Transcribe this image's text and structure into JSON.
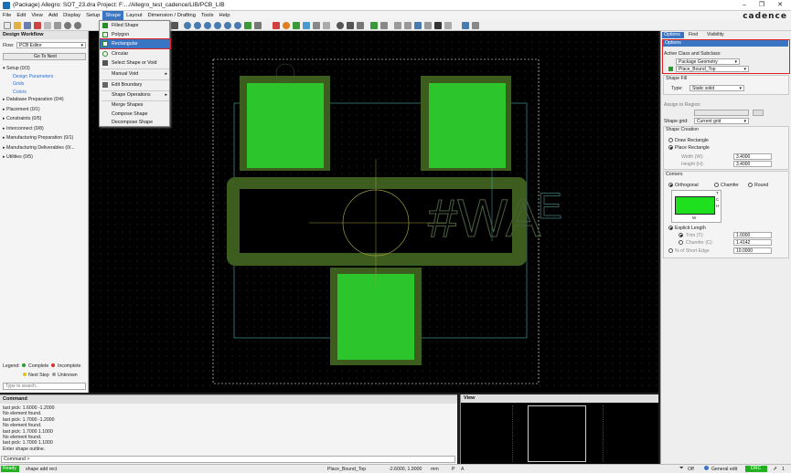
{
  "titlebar": {
    "title": "(Package) Allegro: SOT_23.dra  Project: F:.../Allegro_test_cadence/LIB/PCB_LIB"
  },
  "menubar": {
    "items": [
      "File",
      "Edit",
      "View",
      "Add",
      "Display",
      "Setup",
      "Shape",
      "Layout",
      "Dimension / Drafting",
      "Tools",
      "Help"
    ],
    "active": "Shape"
  },
  "brand": "cadence",
  "shape_menu": {
    "items": [
      "Filled Shape",
      "Polygon",
      "Rectangular",
      "Circular",
      "Select Shape or Void",
      "Manual Void",
      "Edit Boundary",
      "Shape Operations",
      "Merge Shapes",
      "Compose Shape",
      "Decompose Shape"
    ],
    "highlighted": "Rectangular"
  },
  "workflow": {
    "title": "Design Workflow",
    "flow_label": "Flow:",
    "flow_value": "PCB Editor",
    "go_next": "Go To Next",
    "tree": [
      {
        "label": "Setup (0/3)"
      },
      {
        "label": "Design Parameters",
        "sub": true
      },
      {
        "label": "Grids",
        "sub": true
      },
      {
        "label": "Colors",
        "sub": true
      },
      {
        "label": "Database Preparation (0/4)"
      },
      {
        "label": "Placement (0/1)"
      },
      {
        "label": "Constraints (0/5)"
      },
      {
        "label": "Interconnect (0/8)"
      },
      {
        "label": "Manufacturing Preparation (0/1)"
      },
      {
        "label": "Manufacturing Deliverables (0/..."
      },
      {
        "label": "Utilities (0/5)"
      }
    ],
    "legend_label": "Legend:",
    "legend_complete": "Complete",
    "legend_incomplete": "Incomplete",
    "legend_next": "Next Step",
    "legend_unknown": "Unknown",
    "search_placeholder": "Type to search..."
  },
  "options": {
    "tabs": [
      "Options",
      "Find",
      "Visibility"
    ],
    "panel_title": "Options",
    "active_class_label": "Active Class and Subclass:",
    "class_value": "Package Geometry",
    "subclass_value": "Place_Bound_Top",
    "shape_fill_label": "Shape Fill",
    "type_label": "Type:",
    "type_value": "Static solid",
    "assign_label": "Assign to Region:",
    "shape_grid_label": "Shape grid:",
    "shape_grid_value": "Current grid",
    "creation_label": "Shape Creation",
    "draw_rect": "Draw Rectangle",
    "place_rect": "Place Rectangle",
    "width_label": "Width (W):",
    "width_value": "3.4000",
    "height_label": "Height (H):",
    "height_value": "3.4000",
    "corners_label": "Corners",
    "orthogonal": "Orthogonal",
    "chamfer": "Chamfer",
    "round": "Round",
    "explicit_length": "Explicit Length",
    "trim_label": "Trim (T):",
    "trim_value": "1.0000",
    "chamfer_c_label": "Chamfer (C):",
    "chamfer_c_value": "1.4142",
    "short_edge_label": "% of Short Edge",
    "short_edge_value": "10.0000",
    "fig_w": "W",
    "fig_h": "H",
    "fig_c": "C",
    "fig_t": "T",
    "accent": "#1ee01e"
  },
  "command": {
    "title": "Command",
    "lines": [
      "last pick:  1.6000 -1.2000",
      "No element found.",
      "last pick:  1.7000 -1.2000",
      "No element found.",
      "last pick:  1.7000 1.1000",
      "No element found.",
      "last pick:  1.7000 1.1000",
      "Enter shape outline."
    ],
    "prompt": "Command >"
  },
  "view": {
    "title": "View"
  },
  "status": {
    "ready": "Ready",
    "message": "shape add rect",
    "subclass": "Place_Bound_Top",
    "coords": "-2.6000, 1.9000",
    "units": "mm",
    "p": "P",
    "a": "A",
    "off": "Off",
    "edit": "General edit",
    "drc": "DRC",
    "count": "1"
  },
  "canvas_text": {
    "silk": "#WA",
    "ref": "E"
  }
}
